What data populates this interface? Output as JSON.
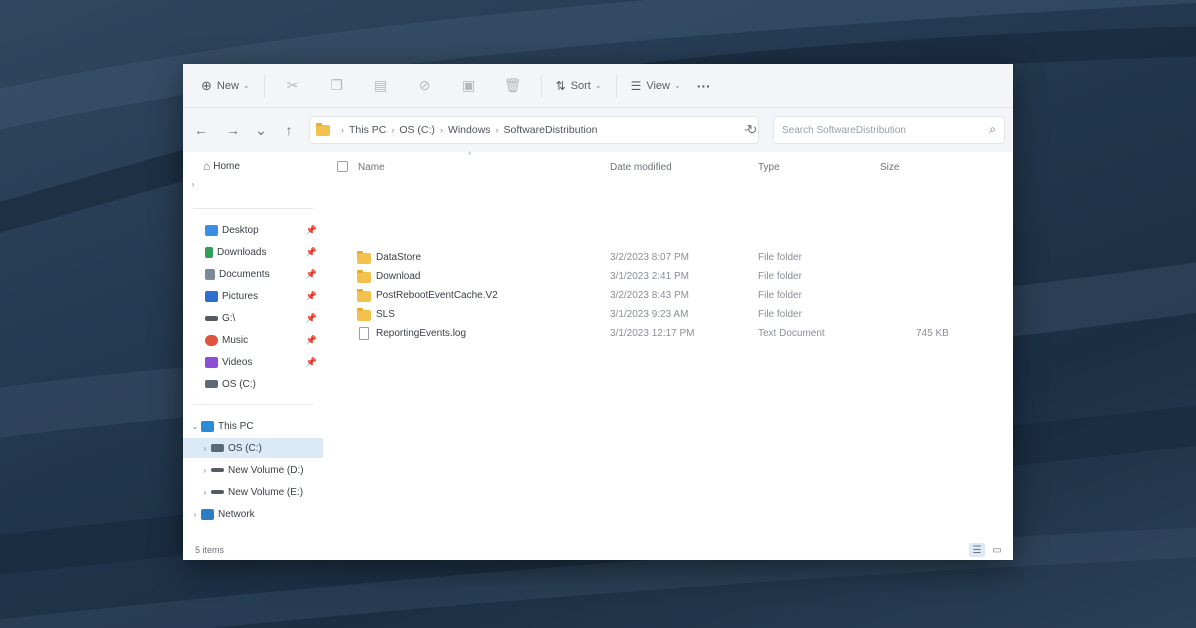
{
  "toolbar": {
    "new_label": "New",
    "sort_label": "Sort",
    "view_label": "View",
    "more_label": "···",
    "icons": [
      "cut-icon",
      "copy-icon",
      "paste-icon",
      "rename-icon",
      "share-icon",
      "delete-icon"
    ]
  },
  "nav": {
    "back": "←",
    "forward": "→",
    "recent": "⌄",
    "up": "↑",
    "breadcrumbs": [
      "This PC",
      "OS (C:)",
      "Windows",
      "SoftwareDistribution"
    ],
    "search_placeholder": "Search SoftwareDistribution"
  },
  "sidebar": {
    "home": "Home",
    "quick": [
      {
        "label": "Desktop",
        "color": "#3a8ee6"
      },
      {
        "label": "Downloads",
        "color": "#2f9e57"
      },
      {
        "label": "Documents",
        "color": "#7c8a99"
      },
      {
        "label": "Pictures",
        "color": "#2d6fd1"
      },
      {
        "label": "G:\\",
        "color": "#555b62"
      },
      {
        "label": "Music",
        "color": "#e0533d"
      },
      {
        "label": "Videos",
        "color": "#8b4fd6"
      },
      {
        "label": "OS (C:)",
        "color": "#5a6a7a"
      }
    ],
    "this_pc": "This PC",
    "drives": [
      {
        "label": "OS (C:)",
        "selected": true
      },
      {
        "label": "New Volume (D:)",
        "selected": false
      },
      {
        "label": "New Volume (E:)",
        "selected": false
      }
    ],
    "network": "Network"
  },
  "columns": {
    "name": "Name",
    "date": "Date modified",
    "type": "Type",
    "size": "Size"
  },
  "files": [
    {
      "name": "DataStore",
      "date": "3/2/2023 8:07 PM",
      "type": "File folder",
      "size": "",
      "kind": "folder"
    },
    {
      "name": "Download",
      "date": "3/1/2023 2:41 PM",
      "type": "File folder",
      "size": "",
      "kind": "folder"
    },
    {
      "name": "PostRebootEventCache.V2",
      "date": "3/2/2023 8:43 PM",
      "type": "File folder",
      "size": "",
      "kind": "folder"
    },
    {
      "name": "SLS",
      "date": "3/1/2023 9:23 AM",
      "type": "File folder",
      "size": "",
      "kind": "folder"
    },
    {
      "name": "ReportingEvents.log",
      "date": "3/1/2023 12:17 PM",
      "type": "Text Document",
      "size": "745 KB",
      "kind": "doc"
    }
  ],
  "status": {
    "count": "5 items"
  }
}
